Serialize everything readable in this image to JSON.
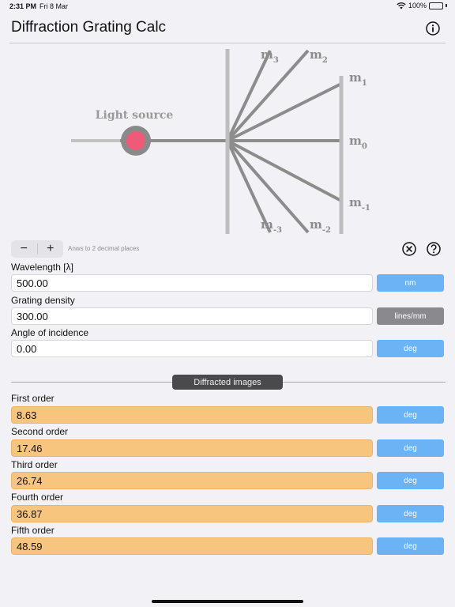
{
  "status_bar": {
    "time": "2:31 PM",
    "date": "Fri 8 Mar",
    "battery": "100%"
  },
  "header": {
    "title": "Diffraction Grating Calc"
  },
  "diagram": {
    "light_source_label": "Light source",
    "orders": [
      {
        "base": "m",
        "sub": "3"
      },
      {
        "base": "m",
        "sub": "2"
      },
      {
        "base": "m",
        "sub": "1"
      },
      {
        "base": "m",
        "sub": "0"
      },
      {
        "base": "m",
        "sub": "-1"
      },
      {
        "base": "m",
        "sub": "-3"
      },
      {
        "base": "m",
        "sub": "-2"
      }
    ],
    "colors": {
      "beam": "#8c8c8c",
      "grating": "#bdbdbd",
      "source": "#ef5a78"
    }
  },
  "controls": {
    "minus": "−",
    "plus": "+",
    "hint": "Anws to 2 decimal places"
  },
  "inputs": [
    {
      "label": "Wavelength [λ]",
      "value": "500.00",
      "unit": "nm"
    },
    {
      "label": "Grating density",
      "value": "300.00",
      "unit": "lines/mm"
    },
    {
      "label": "Angle of incidence",
      "value": "0.00",
      "unit": "deg"
    }
  ],
  "section": {
    "title": "Diffracted images"
  },
  "results": [
    {
      "label": "First order",
      "value": "8.63",
      "unit": "deg"
    },
    {
      "label": "Second order",
      "value": "17.46",
      "unit": "deg"
    },
    {
      "label": "Third order",
      "value": "26.74",
      "unit": "deg"
    },
    {
      "label": "Fourth order",
      "value": "36.87",
      "unit": "deg"
    },
    {
      "label": "Fifth order",
      "value": "48.59",
      "unit": "deg"
    }
  ]
}
